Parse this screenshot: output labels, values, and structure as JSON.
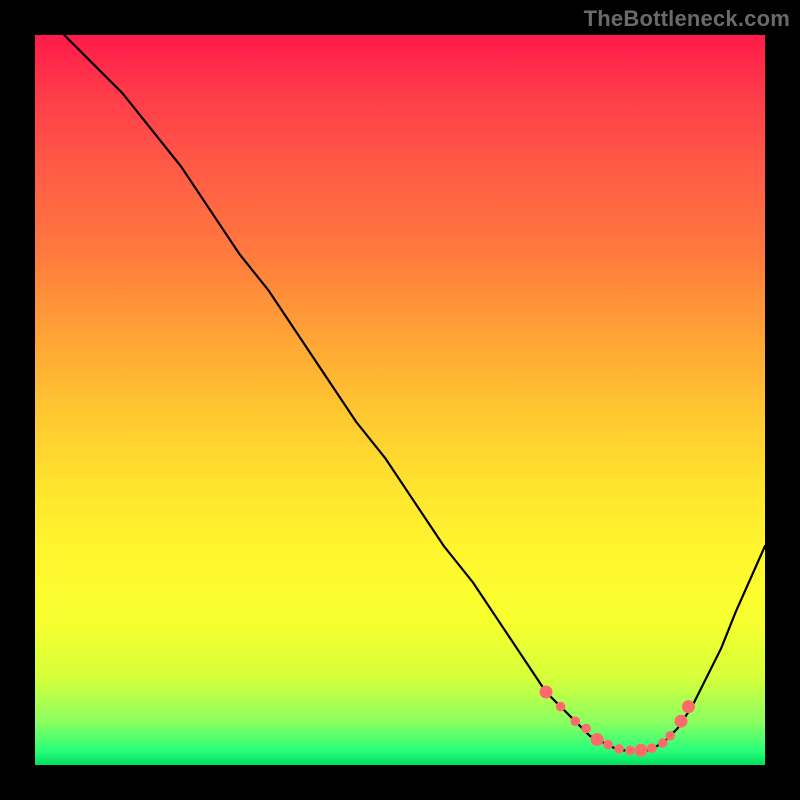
{
  "attribution": "TheBottleneck.com",
  "chart_data": {
    "type": "line",
    "title": "",
    "xlabel": "",
    "ylabel": "",
    "xlim": [
      0,
      100
    ],
    "ylim": [
      0,
      100
    ],
    "grid": false,
    "legend": false,
    "series": [
      {
        "name": "bottleneck-curve",
        "x": [
          4,
          8,
          12,
          16,
          20,
          24,
          28,
          32,
          36,
          40,
          44,
          48,
          52,
          56,
          60,
          64,
          66,
          68,
          70,
          72,
          74,
          76,
          78,
          80,
          82,
          84,
          86,
          88,
          90,
          92,
          94,
          96,
          100
        ],
        "y": [
          100,
          96,
          92,
          87,
          82,
          76,
          70,
          65,
          59,
          53,
          47,
          42,
          36,
          30,
          25,
          19,
          16,
          13,
          10,
          8,
          6,
          4,
          3,
          2,
          2,
          2,
          3,
          5,
          8,
          12,
          16,
          21,
          30
        ]
      }
    ],
    "markers": {
      "name": "highlight-dots",
      "color": "#ff6b6b",
      "points": [
        {
          "x": 70,
          "y": 10
        },
        {
          "x": 72,
          "y": 8
        },
        {
          "x": 74,
          "y": 6
        },
        {
          "x": 75.5,
          "y": 5
        },
        {
          "x": 77,
          "y": 3.5
        },
        {
          "x": 78.5,
          "y": 2.8
        },
        {
          "x": 80,
          "y": 2.2
        },
        {
          "x": 81.5,
          "y": 2
        },
        {
          "x": 83,
          "y": 2
        },
        {
          "x": 84.5,
          "y": 2.3
        },
        {
          "x": 86,
          "y": 3
        },
        {
          "x": 87,
          "y": 4
        },
        {
          "x": 88.5,
          "y": 6
        },
        {
          "x": 89.5,
          "y": 8
        }
      ]
    }
  }
}
